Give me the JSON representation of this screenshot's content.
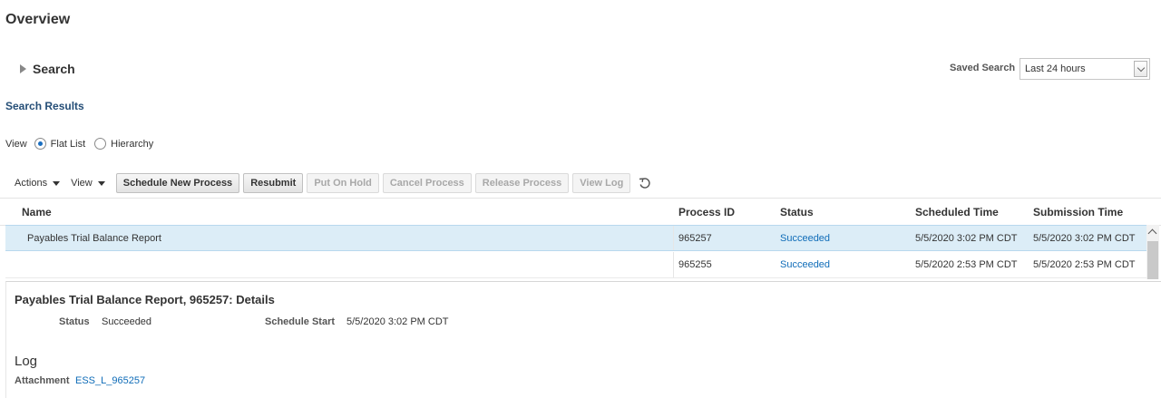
{
  "page": {
    "title": "Overview"
  },
  "search": {
    "label": "Search",
    "saved_search_label": "Saved Search",
    "saved_search_value": "Last 24 hours"
  },
  "results": {
    "title": "Search Results",
    "view_label": "View",
    "view_options": [
      "Flat List",
      "Hierarchy"
    ],
    "view_selected": "Flat List"
  },
  "toolbar": {
    "actions_label": "Actions",
    "view_label": "View",
    "buttons": [
      {
        "label": "Schedule New Process",
        "enabled": true
      },
      {
        "label": "Resubmit",
        "enabled": true
      },
      {
        "label": "Put On Hold",
        "enabled": false
      },
      {
        "label": "Cancel Process",
        "enabled": false
      },
      {
        "label": "Release Process",
        "enabled": false
      },
      {
        "label": "View Log",
        "enabled": false
      }
    ]
  },
  "table": {
    "columns": [
      "Name",
      "Process ID",
      "Status",
      "Scheduled Time",
      "Submission Time"
    ],
    "rows": [
      {
        "name": "Payables Trial Balance Report",
        "process_id": "965257",
        "status": "Succeeded",
        "scheduled_time": "5/5/2020 3:02 PM CDT",
        "submission_time": "5/5/2020 3:02 PM CDT",
        "selected": true
      },
      {
        "name": "",
        "process_id": "965255",
        "status": "Succeeded",
        "scheduled_time": "5/5/2020 2:53 PM CDT",
        "submission_time": "5/5/2020 2:53 PM CDT",
        "selected": false
      }
    ]
  },
  "details": {
    "title": "Payables Trial Balance Report, 965257: Details",
    "status_label": "Status",
    "status_value": "Succeeded",
    "schedule_start_label": "Schedule Start",
    "schedule_start_value": "5/5/2020 3:02 PM CDT",
    "log_heading": "Log",
    "attachment_label": "Attachment",
    "attachment_value": "ESS_L_965257"
  },
  "colors": {
    "link": "#0f6cb8",
    "section_title": "#254e77",
    "selected_row": "#dcedf7"
  },
  "icons": {
    "search_toggle": "triangle-right-icon",
    "refresh": "refresh-icon",
    "dropdown": "chevron-down-icon"
  }
}
